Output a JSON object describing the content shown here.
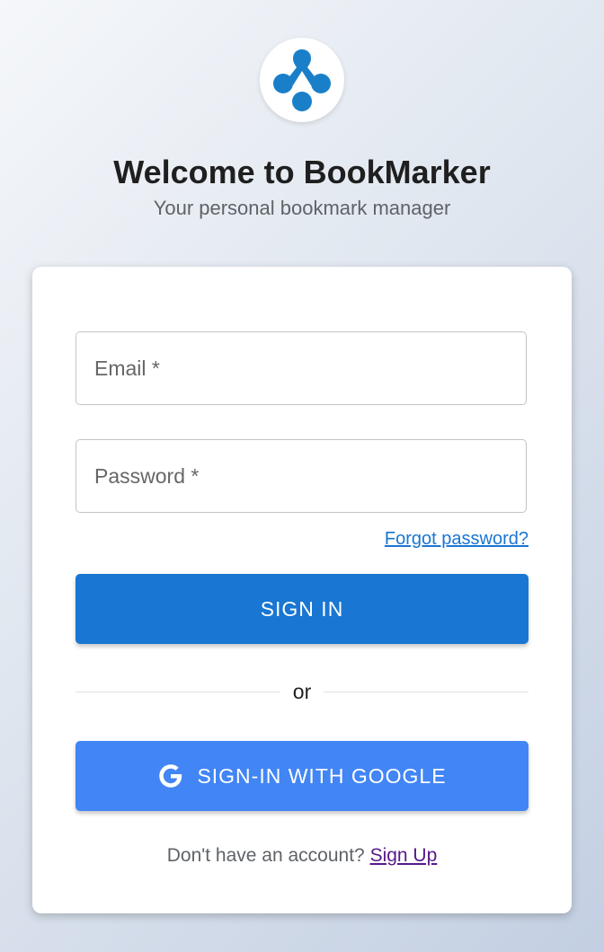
{
  "header": {
    "logo_icon": "bookmarker-logo-icon",
    "title": "Welcome to BookMarker",
    "subtitle": "Your personal bookmark manager"
  },
  "form": {
    "email_label": "Email *",
    "password_label": "Password *",
    "forgot_link": "Forgot password?",
    "signin_label": "SIGN IN",
    "divider_text": "or",
    "google_icon": "google-icon",
    "google_label": "SIGN-IN WITH GOOGLE",
    "signup_prompt": "Don't have an account?",
    "signup_link": "Sign Up"
  },
  "colors": {
    "primary": "#1976d2",
    "google_blue": "#4285f4",
    "logo_blue": "#1a7fc9",
    "visited_link": "#551a8b"
  }
}
